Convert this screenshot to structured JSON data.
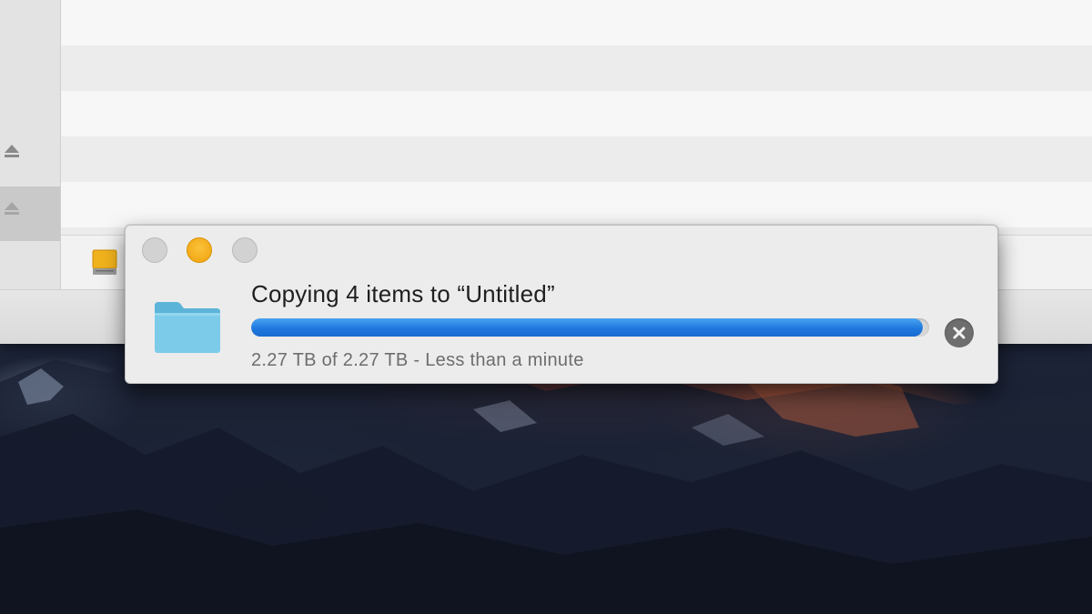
{
  "copy_dialog": {
    "title": "Copying 4 items to “Untitled”",
    "status": "2.27 TB of 2.27 TB - Less than a minute",
    "progress_fraction": 0.99,
    "folder_icon": "folder-icon",
    "stop_icon": "close-x-icon",
    "accent_color": "#1f78de",
    "minimize_color": "#f5b324"
  },
  "finder": {
    "sidebar_icons": [
      "eject-icon",
      "eject-icon"
    ],
    "pathbar_icon": "external-drive-icon"
  },
  "desktop": {
    "wallpaper": "mountain-wallpaper"
  }
}
